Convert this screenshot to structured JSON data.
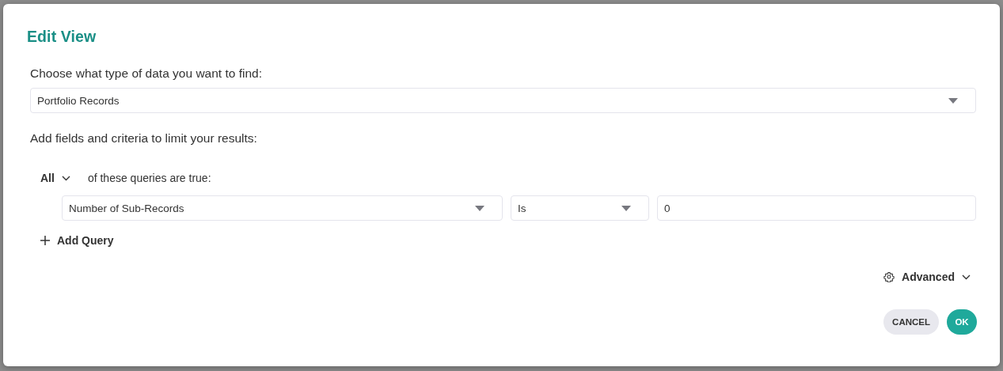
{
  "dialog": {
    "title": "Edit View"
  },
  "data_type": {
    "label": "Choose what type of data you want to find:",
    "value": "Portfolio Records"
  },
  "criteria": {
    "label": "Add fields and criteria to limit your results:",
    "match": "All",
    "match_suffix": "of these queries are true:",
    "queries": [
      {
        "field": "Number of Sub-Records",
        "operator": "Is",
        "value": "0"
      }
    ],
    "add_button": "Add Query"
  },
  "advanced": {
    "label": "Advanced",
    "expanded": false
  },
  "buttons": [
    {
      "label": "CANCEL",
      "kind": "secondary"
    },
    {
      "label": "OK",
      "kind": "primary"
    }
  ]
}
